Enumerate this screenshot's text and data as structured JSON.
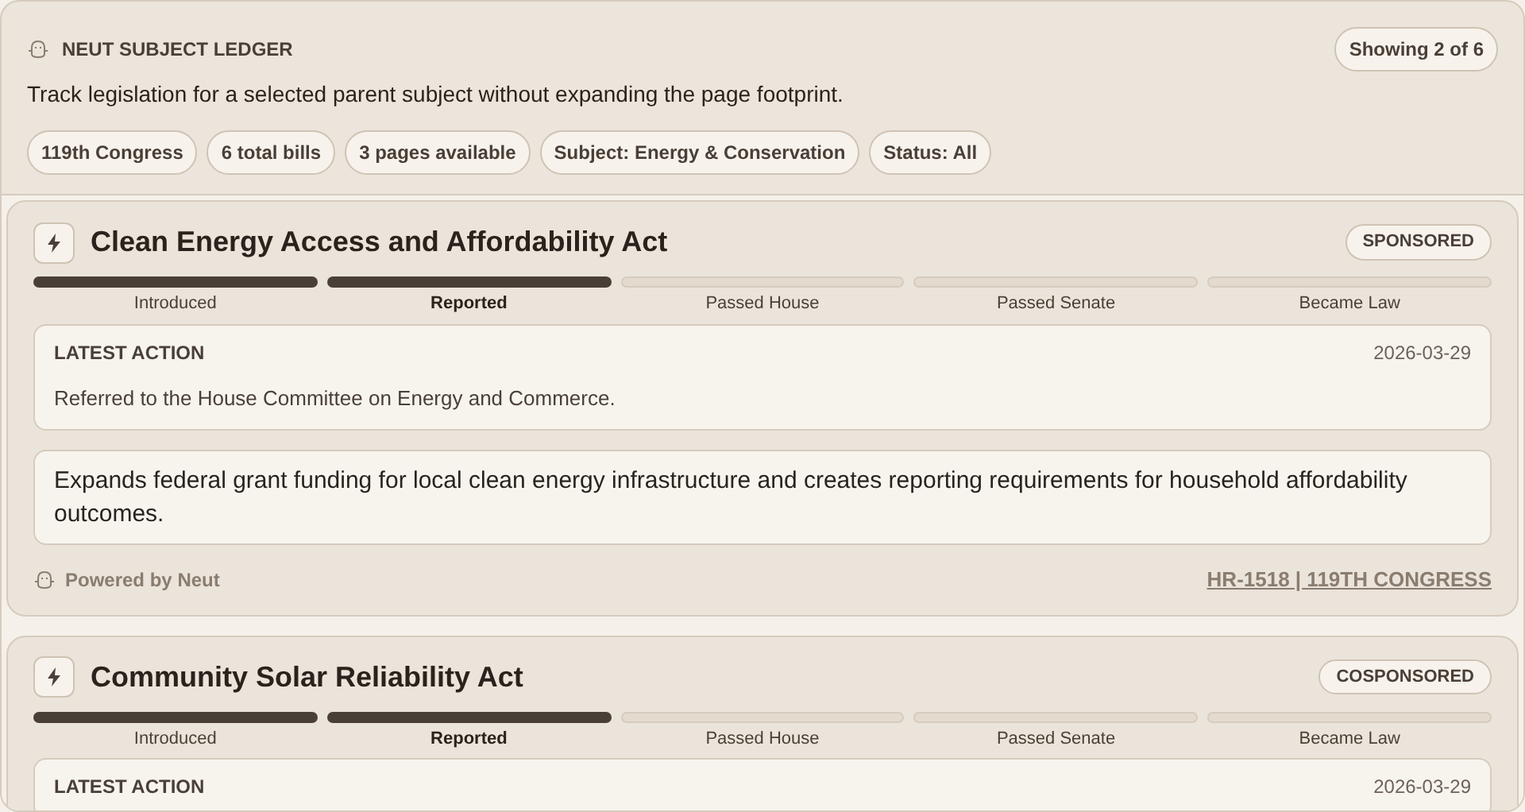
{
  "header": {
    "title": "NEUT SUBJECT LEDGER",
    "count": "Showing 2 of 6",
    "description": "Track legislation for a selected parent subject without expanding the page footprint.",
    "chips": [
      "119th Congress",
      "6 total bills",
      "3 pages available",
      "Subject: Energy & Conservation",
      "Status: All"
    ]
  },
  "bills": [
    {
      "title": "Clean Energy Access and Affordability Act",
      "badge": "SPONSORED",
      "stages": [
        {
          "label": "Introduced",
          "done": true,
          "current": false
        },
        {
          "label": "Reported",
          "done": true,
          "current": true
        },
        {
          "label": "Passed House",
          "done": false,
          "current": false
        },
        {
          "label": "Passed Senate",
          "done": false,
          "current": false
        },
        {
          "label": "Became Law",
          "done": false,
          "current": false
        }
      ],
      "action_label": "LATEST ACTION",
      "action_date": "2026-03-29",
      "action_text": "Referred to the House Committee on Energy and Commerce.",
      "summary": "Expands federal grant funding for local clean energy infrastructure and creates reporting requirements for household affordability outcomes.",
      "powered_by": "Powered by Neut",
      "reference": "HR-1518 | 119TH CONGRESS"
    },
    {
      "title": "Community Solar Reliability Act",
      "badge": "COSPONSORED",
      "stages": [
        {
          "label": "Introduced",
          "done": true,
          "current": false
        },
        {
          "label": "Reported",
          "done": true,
          "current": true
        },
        {
          "label": "Passed House",
          "done": false,
          "current": false
        },
        {
          "label": "Passed Senate",
          "done": false,
          "current": false
        },
        {
          "label": "Became Law",
          "done": false,
          "current": false
        }
      ],
      "action_label": "LATEST ACTION",
      "action_date": "2026-03-29"
    }
  ]
}
